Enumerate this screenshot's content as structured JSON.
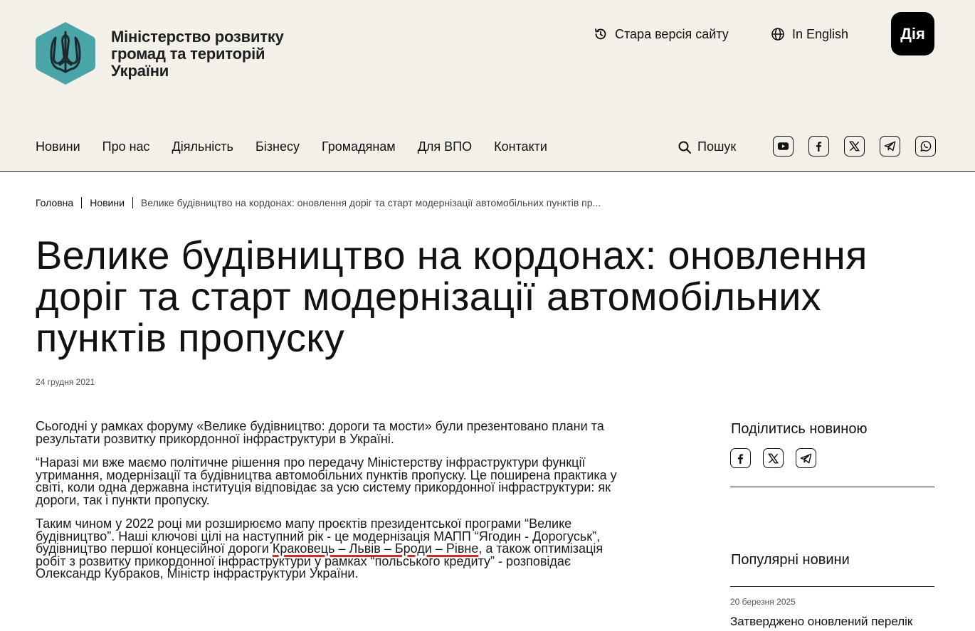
{
  "colors": {
    "header_bg": "#f3f0e9",
    "logo_teal": "#4aa5a8",
    "accent_underline": "#e0242a",
    "diia_bg": "#000000"
  },
  "header": {
    "ministry_name_lines": [
      "Міністерство розвитку",
      "громад та територій",
      "України"
    ],
    "old_site_label": "Стара версія сайту",
    "english_label": "In English",
    "diia_label": "Дія",
    "logo_icon": "trident-icon"
  },
  "nav": {
    "items": [
      "Новини",
      "Про нас",
      "Діяльність",
      "Бізнесу",
      "Громадянам",
      "Для ВПО",
      "Контакти"
    ],
    "search_label": "Пошук",
    "social_icons": [
      "youtube-icon",
      "facebook-icon",
      "x-icon",
      "telegram-icon",
      "whatsapp-icon"
    ]
  },
  "breadcrumb": {
    "home": "Головна",
    "news": "Новини",
    "current": "Велике будівництво на кордонах: оновлення доріг та старт модернізації автомобільних пунктів пр..."
  },
  "article": {
    "title": "Велике будівництво на кордонах: оновлення доріг та старт модернізації автомобільних пунктів пропуску",
    "date": "24 грудня 2021",
    "paragraph1": "Сьогодні у рамках форуму «Велике будівництво: дороги та мости» були презентовано плани та результати розвитку прикордонної інфраструктури в Україні.",
    "paragraph2": "“Наразі ми вже маємо політичне рішення про передачу Міністерству інфраструктури функції утримання, модернізації та будівництва автомобільних пунктів пропуску. Це поширена практика у світі, коли одна державна інституція відповідає за усю систему прикордонної інфраструктури: як дороги, так і пункти пропуску.",
    "paragraph3_before": "Таким чином у 2022 році ми розширюємо мапу проєктів президентської програми “Велике будівництво”. Наші ключові цілі на наступний рік - це модернізація МАПП “Ягодин - Дорогуськ”, будівництво першої концесійної дороги ",
    "paragraph3_underlined": "Краковець – Львів – Броди – Рівне",
    "paragraph3_after": ", а також оптимізація робіт з розвитку прикордонної інфраструктури у рамках “польського кредиту” - розповідає Олександр Кубраков, Міністр інфраструктури України."
  },
  "sidebar": {
    "share_title": "Поділитись новиною",
    "share_icons": [
      "facebook-icon",
      "x-icon",
      "telegram-icon"
    ],
    "popular_title": "Популярні новини",
    "popular_items": [
      {
        "date": "20 березня 2025",
        "headline": "Затверджено оновлений перелік"
      }
    ]
  }
}
